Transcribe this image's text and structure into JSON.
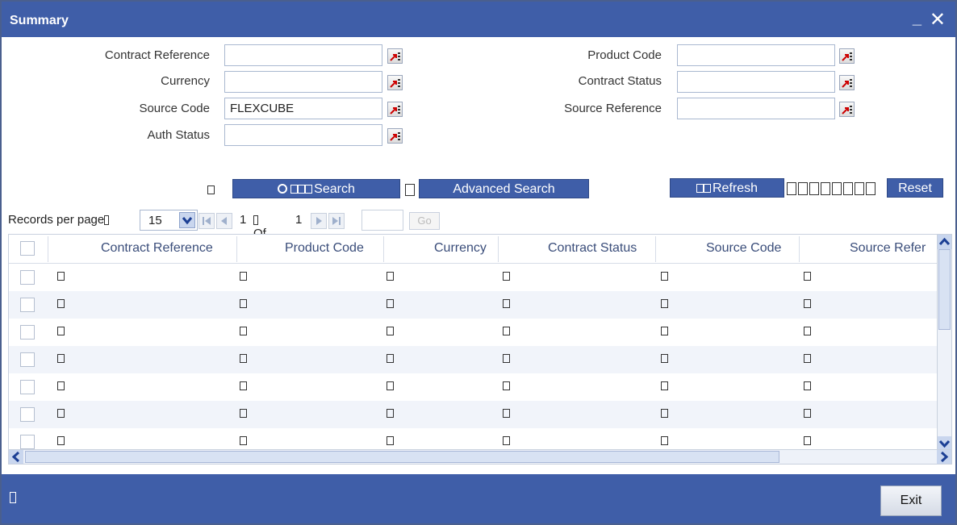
{
  "window": {
    "title": "Summary",
    "minimize_label": "_",
    "close_label": "✕"
  },
  "form": {
    "contract_reference": {
      "label": "Contract Reference",
      "value": ""
    },
    "currency": {
      "label": "Currency",
      "value": ""
    },
    "source_code": {
      "label": "Source Code",
      "value": "FLEXCUBE"
    },
    "auth_status": {
      "label": "Auth Status",
      "value": ""
    },
    "product_code": {
      "label": "Product Code",
      "value": ""
    },
    "contract_status": {
      "label": "Contract Status",
      "value": ""
    },
    "source_reference": {
      "label": "Source Reference",
      "value": ""
    }
  },
  "actions": {
    "search_label": "Search",
    "advanced_search_label": "Advanced Search",
    "refresh_label": "Refresh",
    "reset_label": "Reset"
  },
  "pager": {
    "records_per_page_label": "Records per page",
    "records_per_page_value": "15",
    "current_page": "1",
    "of_label": "Of",
    "total_pages": "1",
    "go_label": "Go"
  },
  "grid": {
    "columns": [
      "Contract Reference",
      "Product Code",
      "Currency",
      "Contract Status",
      "Source Code",
      "Source Refer"
    ],
    "row_count": 7
  },
  "footer": {
    "exit_label": "Exit"
  },
  "colors": {
    "titlebar": "#3f5ea8",
    "header_text": "#3a4d7a",
    "alt_row": "#f1f4fa"
  },
  "icons": [
    "lov-icon",
    "search-icon",
    "first-page-icon",
    "prev-page-icon",
    "next-page-icon",
    "last-page-icon",
    "scroll-up-icon",
    "scroll-down-icon",
    "scroll-left-icon",
    "scroll-right-icon"
  ]
}
